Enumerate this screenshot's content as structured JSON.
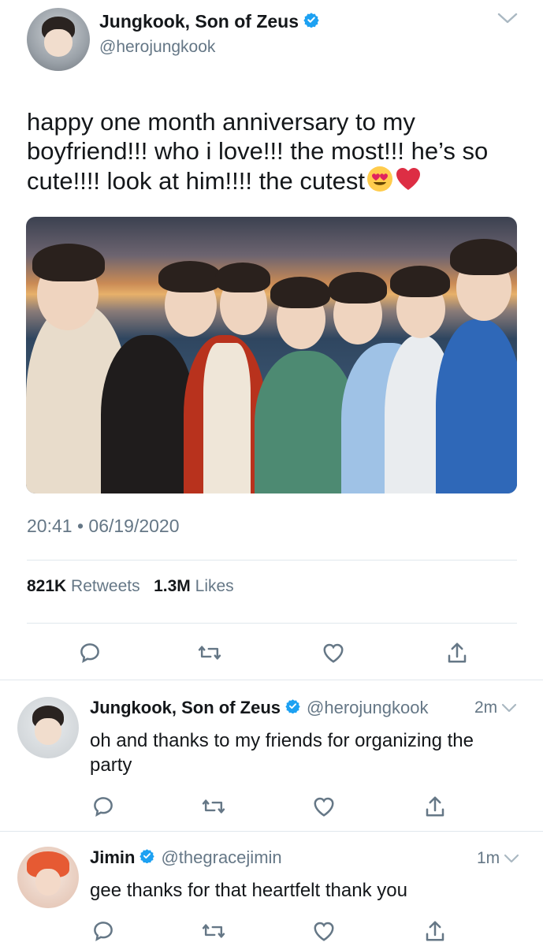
{
  "main_tweet": {
    "display_name": "Jungkook, Son of Zeus",
    "handle": "@herojungkook",
    "text": "happy one month anniversary to my boyfriend!!! who i love!!! the most!!! he’s so cute!!!! look at him!!!! the cutest",
    "time": "20:41",
    "separator": "•",
    "date": "06/19/2020",
    "retweets_count": "821K",
    "retweets_label": "Retweets",
    "likes_count": "1.3M",
    "likes_label": "Likes"
  },
  "replies": [
    {
      "display_name": "Jungkook, Son of Zeus",
      "handle": "@herojungkook",
      "time_ago": "2m",
      "text": "oh and thanks to my friends for organizing the party"
    },
    {
      "display_name": "Jimin",
      "handle": "@thegracejimin",
      "time_ago": "1m",
      "text": "gee thanks for that heartfelt thank you"
    }
  ],
  "icons": {
    "verified": "verified-badge-icon",
    "reply": "reply-icon",
    "retweet": "retweet-icon",
    "like": "heart-icon",
    "share": "share-icon",
    "more": "chevron-down-icon",
    "emoji_1": "heart-eyes-emoji",
    "emoji_2": "red-heart-emoji"
  },
  "colors": {
    "text": "#14171a",
    "secondary": "#657786",
    "verified": "#1da1f2",
    "divider": "#e1e8ed"
  }
}
